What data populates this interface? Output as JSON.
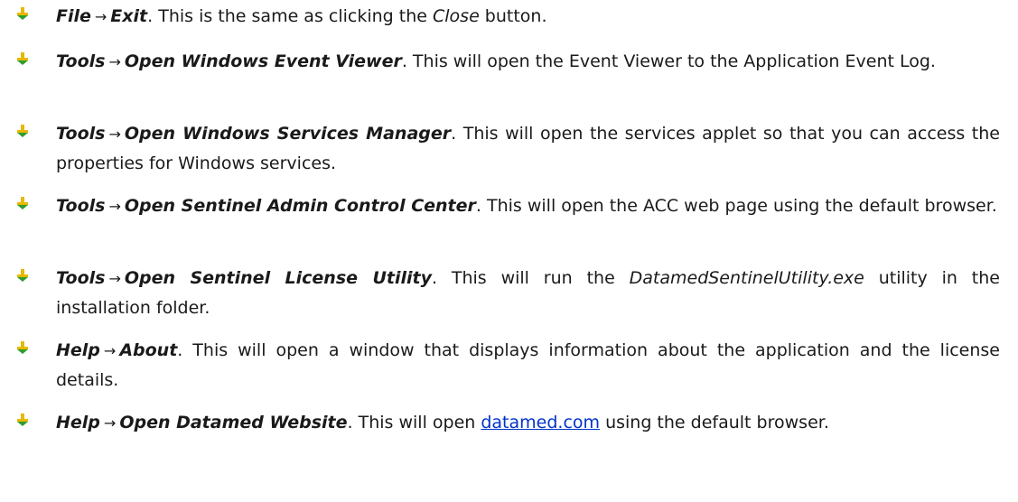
{
  "bullet_colors": {
    "top": "#e8b800",
    "bottom": "#2f9e2f"
  },
  "bullet_icon": "arrow-down-bullet-icon",
  "entries": [
    {
      "menu": "File",
      "arrow": "→",
      "command": "Exit",
      "period": ".",
      "desc_a": " This is the same as clicking the ",
      "desc_italic": "Close",
      "desc_b": " button."
    },
    {
      "menu": "Tools",
      "arrow": "→",
      "command": "Open Windows Event Viewer",
      "period": ".",
      "desc_a": " This will open the Event Viewer to the Application Event Log."
    },
    {
      "menu": "Tools",
      "arrow": "→",
      "command": "Open Windows Services Manager",
      "period": ".",
      "desc_a": " This will open the services applet so that you can access the properties for Windows services."
    },
    {
      "menu": "Tools",
      "arrow": "→",
      "command": "Open Sentinel Admin Control Center",
      "period": ".",
      "desc_a": " This will open the ACC web page using the default browser."
    },
    {
      "menu": "Tools",
      "arrow": "→",
      "command": "Open Sentinel License Utility",
      "period": ".",
      "desc_a": " This will run the ",
      "desc_italic": "DatamedSentinelUtility.exe",
      "desc_b": " utility in the installation folder."
    },
    {
      "menu": "Help",
      "arrow": "→",
      "command": "About",
      "period": ".",
      "desc_a": " This will open a window that displays information about the application and the license details."
    },
    {
      "menu": "Help",
      "arrow": "→",
      "command": "Open Datamed Website",
      "period": ".",
      "desc_a": " This will open ",
      "desc_link": "datamed.com",
      "desc_b": " using the default browser."
    }
  ]
}
